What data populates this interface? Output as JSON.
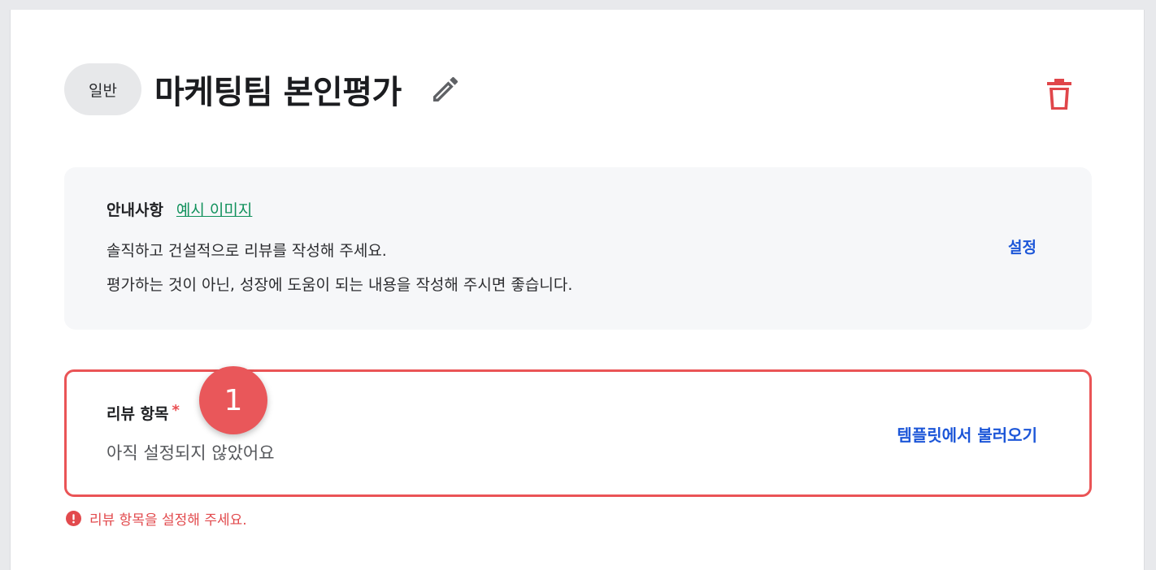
{
  "header": {
    "badge": "일반",
    "title": "마케팅팀 본인평가",
    "edit_icon": "pencil-icon",
    "delete_icon": "trash-icon"
  },
  "notice": {
    "label": "안내사항",
    "example_link": "예시 이미지",
    "line1": "솔직하고 건설적으로 리뷰를 작성해 주세요.",
    "line2": "평가하는 것이 아닌, 성장에 도움이 되는 내용을 작성해 주시면 좋습니다.",
    "settings_link": "설정"
  },
  "review_items": {
    "label": "리뷰 항목",
    "required_mark": "*",
    "empty_text": "아직 설정되지 않았어요",
    "template_link": "템플릿에서 불러오기"
  },
  "step_marker": "1",
  "error": {
    "message": "리뷰 항목을 설정해 주세요.",
    "icon": "exclamation-circle-icon"
  },
  "colors": {
    "accent_blue": "#1c56d8",
    "link_green": "#11915c",
    "error_red": "#ea5456",
    "delete_red": "#e0464a"
  }
}
